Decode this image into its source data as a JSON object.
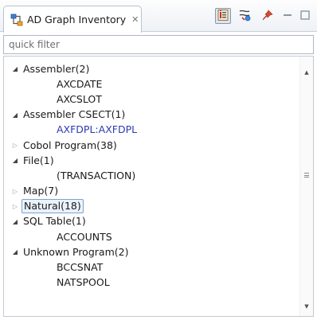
{
  "view": {
    "title": "AD Graph Inventory",
    "close_symbol": "✕"
  },
  "toolbar": {
    "buttons": [
      {
        "name": "link-with-editor-icon",
        "pressed": true
      },
      {
        "name": "graph-filter-icon",
        "pressed": false
      },
      {
        "name": "pin-icon",
        "pressed": false
      }
    ],
    "minimize_symbol": "—",
    "maximize_symbol": "□"
  },
  "filter": {
    "placeholder": "quick filter",
    "value": ""
  },
  "tree": {
    "items": [
      {
        "label": "Assembler(2)",
        "level": 0,
        "expanded": true
      },
      {
        "label": "AXCDATE",
        "level": 1
      },
      {
        "label": "AXCSLOT",
        "level": 1
      },
      {
        "label": "Assembler CSECT(1)",
        "level": 0,
        "expanded": true
      },
      {
        "label": "AXFDPL:AXFDPL",
        "level": 1,
        "link": true
      },
      {
        "label": "Cobol Program(38)",
        "level": 0,
        "expanded": false
      },
      {
        "label": "File(1)",
        "level": 0,
        "expanded": true
      },
      {
        "label": "(TRANSACTION)",
        "level": 1
      },
      {
        "label": "Map(7)",
        "level": 0,
        "expanded": false
      },
      {
        "label": "Natural(18)",
        "level": 0,
        "expanded": false,
        "selected": true
      },
      {
        "label": "SQL Table(1)",
        "level": 0,
        "expanded": true
      },
      {
        "label": "ACCOUNTS",
        "level": 1
      },
      {
        "label": "Unknown Program(2)",
        "level": 0,
        "expanded": true
      },
      {
        "label": "BCCSNAT",
        "level": 1
      },
      {
        "label": "NATSPOOL",
        "level": 1
      }
    ]
  },
  "colors": {
    "link": "#2a3bb0",
    "selection_border": "#7da2ce",
    "selection_fill": "#eaf2fb"
  }
}
